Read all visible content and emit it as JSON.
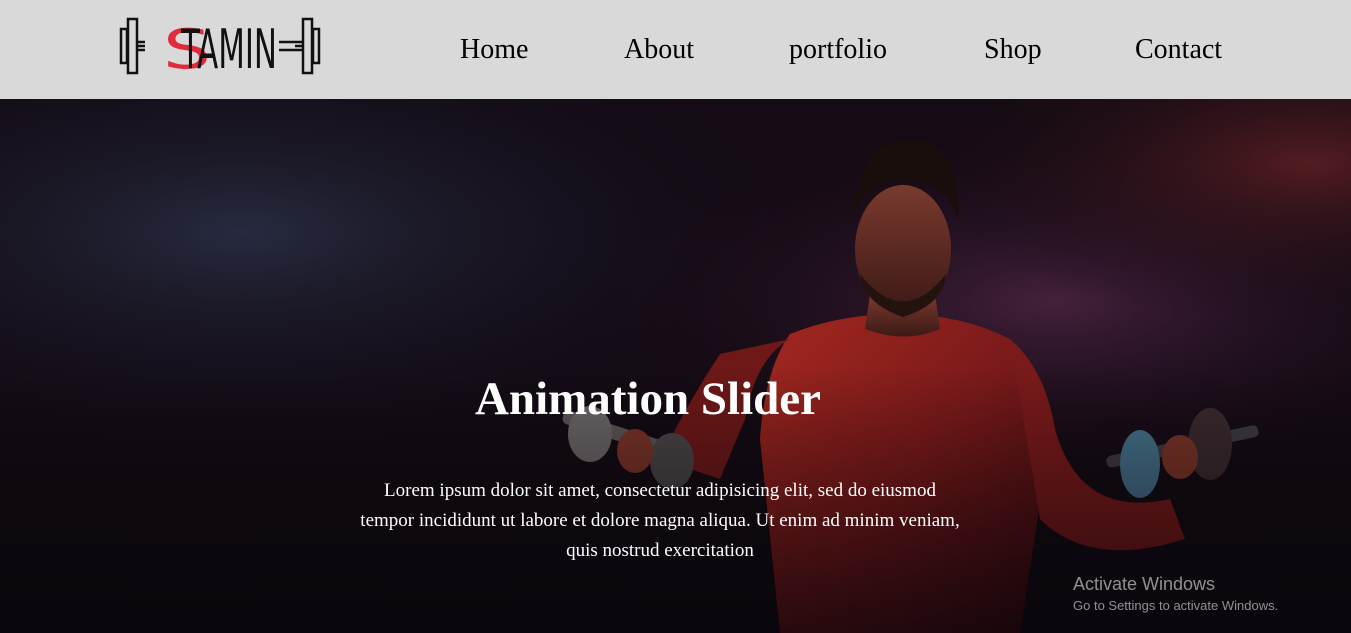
{
  "header": {
    "logo_text": "STAMIN",
    "logo_accent_letter": "S",
    "logo_rest": "TAMIN",
    "accent_color": "#e02b3a",
    "nav": [
      {
        "label": "Home"
      },
      {
        "label": "About"
      },
      {
        "label": "portfolio"
      },
      {
        "label": "Shop"
      },
      {
        "label": "Contact"
      }
    ]
  },
  "hero": {
    "title": "Animation Slider",
    "text": "Lorem ipsum dolor sit amet, consectetur adipisicing elit, sed do eiusmod tempor incididunt ut labore et dolore magna aliqua. Ut enim ad minim veniam, quis nostrud exercitation",
    "background_image": "man-lifting-dumbbells-photo"
  },
  "watermark": {
    "title": "Activate Windows",
    "subtitle": "Go to Settings to activate Windows."
  }
}
